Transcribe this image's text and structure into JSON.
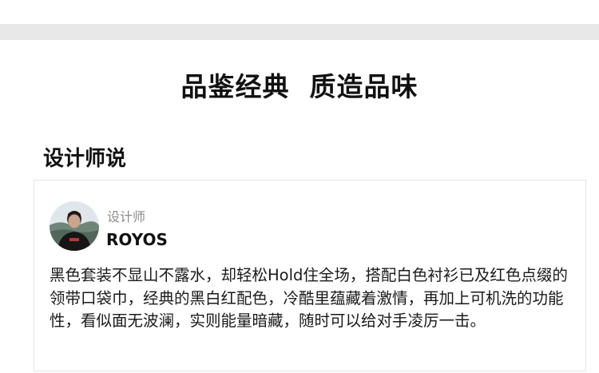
{
  "page": {
    "title": "品鉴经典  质造品味"
  },
  "designer_section": {
    "heading": "设计师说",
    "card": {
      "avatar_icon": "designer-portrait",
      "role_label": "设计师",
      "name": "ROYOS",
      "quote": "黑色套装不显山不露水，却轻松Hold住全场，搭配白色衬衫已及红色点缀的领带口袋巾，经典的黑白红配色，冷酷里蕴藏着激情，再加上可机洗的功能性，看似面无波澜，实则能量暗藏，随时可以给对手凌厉一击。"
    }
  },
  "colors": {
    "band": "#e8e8e8",
    "text": "#111111",
    "muted": "#8a8a8a",
    "border": "#e4e4e4"
  }
}
